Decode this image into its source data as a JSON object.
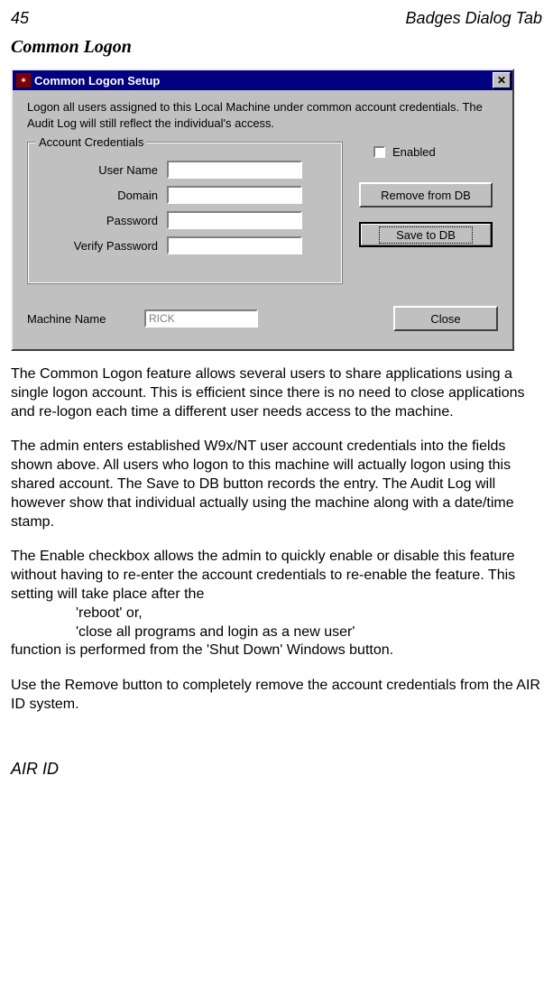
{
  "page": {
    "number": "45",
    "header": "Badges Dialog Tab",
    "section_title": "Common Logon",
    "footer": "AIR ID"
  },
  "dialog": {
    "title": "Common Logon Setup",
    "description": "Logon all users assigned to this Local Machine under common account credentials.  The Audit Log will still reflect the individual's access.",
    "fieldset_legend": "Account Credentials",
    "fields": {
      "username_label": "User Name",
      "domain_label": "Domain",
      "password_label": "Password",
      "verify_label": "Verify Password"
    },
    "enabled_label": "Enabled",
    "buttons": {
      "remove": "Remove from DB",
      "save": "Save to DB",
      "close": "Close"
    },
    "machine_name_label": "Machine Name",
    "machine_name_value": "RICK"
  },
  "paragraphs": {
    "p1": "The Common Logon feature allows several users to share applications using a single logon account.  This is efficient since there is no need to close applications and re-logon each time a different user needs access to the machine.",
    "p2": "The admin enters established W9x/NT user account credentials into the fields shown above.  All users who logon to this machine will actually logon using this shared account.  The Save to DB button records the entry. The Audit Log will however show that individual actually using the machine along with a date/time stamp.",
    "p3a": "The Enable checkbox allows the admin to quickly enable or disable this feature without having to re-enter the account credentials to re-enable the feature.  This setting will take place after the",
    "p3b": "'reboot' or,",
    "p3c": "'close all programs and login as a new user'",
    "p3d": "function is performed from the 'Shut Down' Windows button.",
    "p4": "Use the Remove button to completely remove the account credentials from the AIR ID system."
  }
}
